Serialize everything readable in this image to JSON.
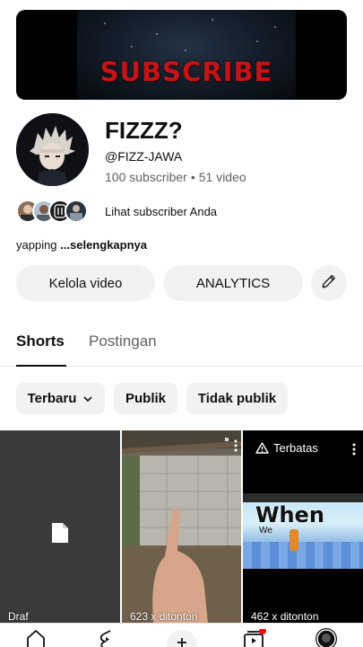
{
  "banner": {
    "text": "SUBSCRIBE"
  },
  "channel": {
    "name": "FIZZZ?",
    "handle": "@FIZZ-JAWA",
    "subscribers": "100 subscriber",
    "separator": "•",
    "videos": "51 video"
  },
  "subscribers_link": "Lihat subscriber Anda",
  "description": {
    "text": "yapping",
    "more": "...selengkapnya"
  },
  "actions": {
    "manage": "Kelola video",
    "analytics": "ANALYTICS"
  },
  "tabs": [
    {
      "label": "Shorts",
      "active": true
    },
    {
      "label": "Postingan",
      "active": false
    }
  ],
  "filters": [
    {
      "label": "Terbaru",
      "icon": "chevron-down-icon"
    },
    {
      "label": "Publik"
    },
    {
      "label": "Tidak publik"
    }
  ],
  "shorts": [
    {
      "label": "Draf",
      "icon": "file-icon"
    },
    {
      "label": "623 x ditonton"
    },
    {
      "label": "462 x ditonton",
      "badge": "Terbatas",
      "thumb_text": "When",
      "thumb_subtext": "We"
    }
  ],
  "bottom_nav": [
    "home-icon",
    "shorts-icon",
    "create-icon",
    "subscriptions-icon",
    "you-icon"
  ],
  "colors": {
    "accent_red": "#c4141a",
    "chip_bg": "#f2f2f2",
    "text_secondary": "#606060",
    "notification": "#ff0000"
  }
}
